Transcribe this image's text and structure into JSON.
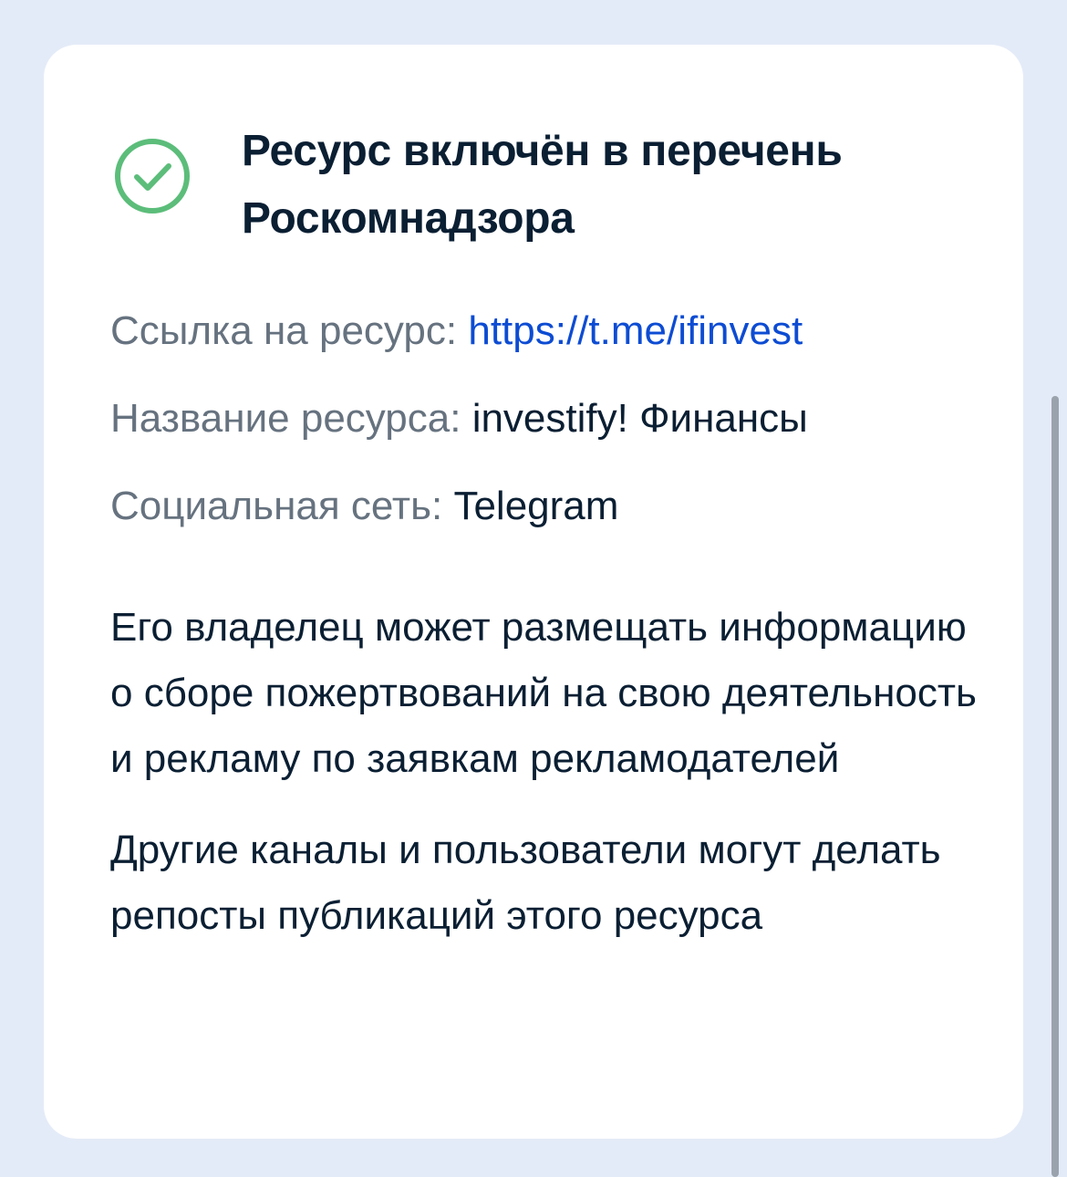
{
  "card": {
    "icon": "check-circle-icon",
    "title": "Ресурс включён в перечень Роскомнадзора",
    "details": {
      "link_label": "Ссылка на ресурс: ",
      "link_value": "https://t.me/ifinvest",
      "name_label": "Название ресурса: ",
      "name_value": "investify! Финансы",
      "network_label": "Социальная сеть: ",
      "network_value": "Telegram"
    },
    "paragraphs": [
      "Его владелец может размещать информацию о сборе пожертвований на свою деятельность и рекламу по заявкам рекламодателей",
      "Другие каналы и пользователи могут делать репосты публикаций этого ресурса"
    ]
  },
  "colors": {
    "background": "#e4ebf8",
    "card": "#ffffff",
    "text": "#0b1f33",
    "label": "#66727f",
    "link": "#0d4cd3",
    "success": "#5cbd7a"
  }
}
